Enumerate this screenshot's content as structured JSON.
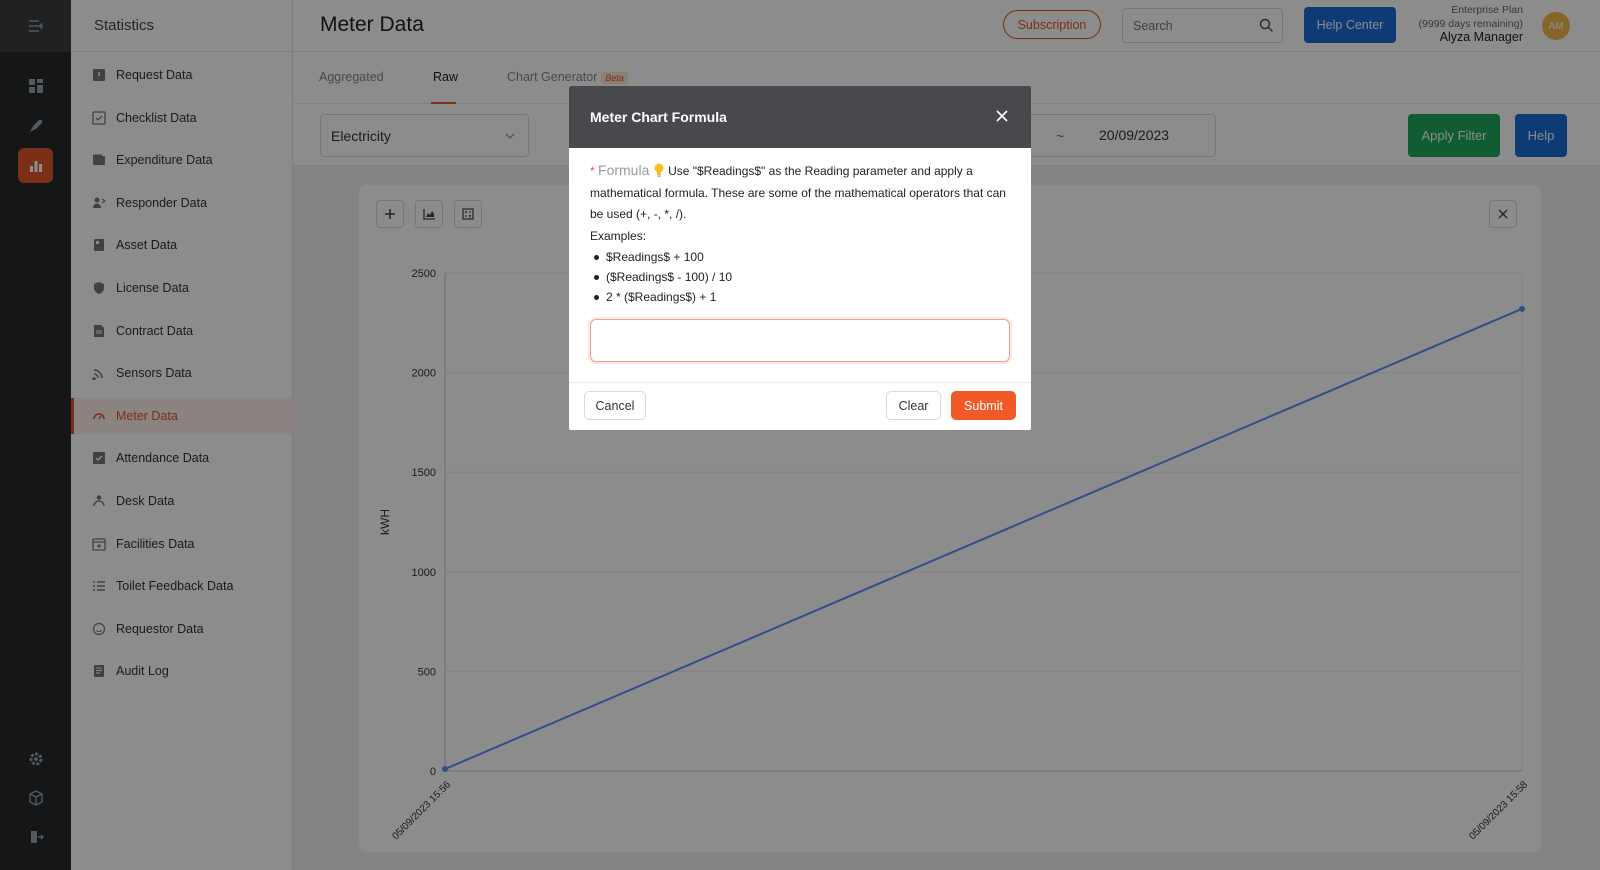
{
  "sidebar": {
    "title": "Statistics",
    "items": [
      {
        "label": "Request Data",
        "icon": "request-icon"
      },
      {
        "label": "Checklist Data",
        "icon": "checklist-icon"
      },
      {
        "label": "Expenditure Data",
        "icon": "wallet-icon"
      },
      {
        "label": "Responder Data",
        "icon": "responder-icon"
      },
      {
        "label": "Asset Data",
        "icon": "asset-icon"
      },
      {
        "label": "License Data",
        "icon": "shield-icon"
      },
      {
        "label": "Contract Data",
        "icon": "contract-icon"
      },
      {
        "label": "Sensors Data",
        "icon": "signal-icon"
      },
      {
        "label": "Meter Data",
        "icon": "gauge-icon"
      },
      {
        "label": "Attendance Data",
        "icon": "attendance-icon"
      },
      {
        "label": "Desk Data",
        "icon": "desk-icon"
      },
      {
        "label": "Facilities Data",
        "icon": "calendar-icon"
      },
      {
        "label": "Toilet Feedback Data",
        "icon": "list-icon"
      },
      {
        "label": "Requestor Data",
        "icon": "smile-icon"
      },
      {
        "label": "Audit Log",
        "icon": "log-icon"
      }
    ],
    "active_index": 8
  },
  "header": {
    "title": "Meter Data",
    "subscription": "Subscription",
    "search_placeholder": "Search",
    "help_center": "Help Center",
    "plan": "Enterprise Plan",
    "days": "(9999 days remaining)",
    "user": "Alyza Manager",
    "avatar": "AM"
  },
  "tabs": {
    "aggregated": "Aggregated",
    "raw": "Raw",
    "chart_generator": "Chart Generator",
    "beta": "Beta"
  },
  "filter": {
    "meter_type": "Electricity",
    "tilde": "~",
    "end_date": "20/09/2023",
    "apply": "Apply Filter",
    "help": "Help"
  },
  "colors": {
    "accent": "#e0562b",
    "line": "#5b8ff9",
    "apply": "#1fa85b",
    "blue": "#1a6bd6"
  },
  "chart_data": {
    "type": "line",
    "ylabel": "kWH",
    "ylim": [
      0,
      2500
    ],
    "yticks": [
      "0",
      "500",
      "1000",
      "1500",
      "2000",
      "2500"
    ],
    "x": [
      "05/09/2023 15:56",
      "05/09/2023 15:58"
    ],
    "series": [
      {
        "values": [
          10,
          2320
        ]
      }
    ]
  },
  "modal": {
    "title": "Meter Chart Formula",
    "required_mark": "*",
    "label": "Formula",
    "desc": "Use \"$Readings$\" as the Reading parameter and apply a mathematical formula. These are some of the mathematical operators that can be used (+, -, *, /).",
    "examples_title": "Examples:",
    "examples": [
      "$Readings$ + 100",
      "($Readings$ - 100) / 10",
      "2 * ($Readings$) + 1"
    ],
    "input_value": "",
    "cancel": "Cancel",
    "clear": "Clear",
    "submit": "Submit"
  }
}
